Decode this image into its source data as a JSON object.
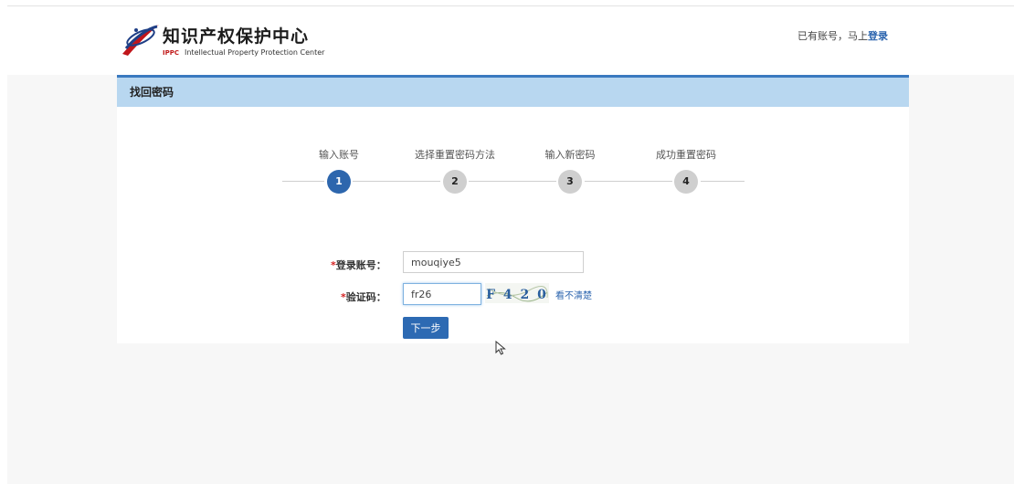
{
  "header": {
    "logo_title": "知识产权保护中心",
    "logo_abbr": "IPPC",
    "logo_subtitle": "Intellectual Property Protection Center",
    "account_prompt": "已有账号，马上",
    "login_link": "登录"
  },
  "panel": {
    "title": "找回密码"
  },
  "steps": [
    {
      "label": "输入账号",
      "number": "1",
      "active": true
    },
    {
      "label": "选择重置密码方法",
      "number": "2",
      "active": false
    },
    {
      "label": "输入新密码",
      "number": "3",
      "active": false
    },
    {
      "label": "成功重置密码",
      "number": "4",
      "active": false
    }
  ],
  "form": {
    "required_mark": "*",
    "account_label": "登录账号：",
    "account_value": "mouqiye5",
    "captcha_label": "验证码：",
    "captcha_value": "fr26",
    "captcha_image_text": "F 4 2 0",
    "refresh_link": "看不清楚",
    "next_button": "下一步"
  },
  "colors": {
    "accent": "#2d66ad",
    "panel_header_bg": "#b8d7f0",
    "panel_header_border": "#3a79bf",
    "required": "#d42323"
  }
}
